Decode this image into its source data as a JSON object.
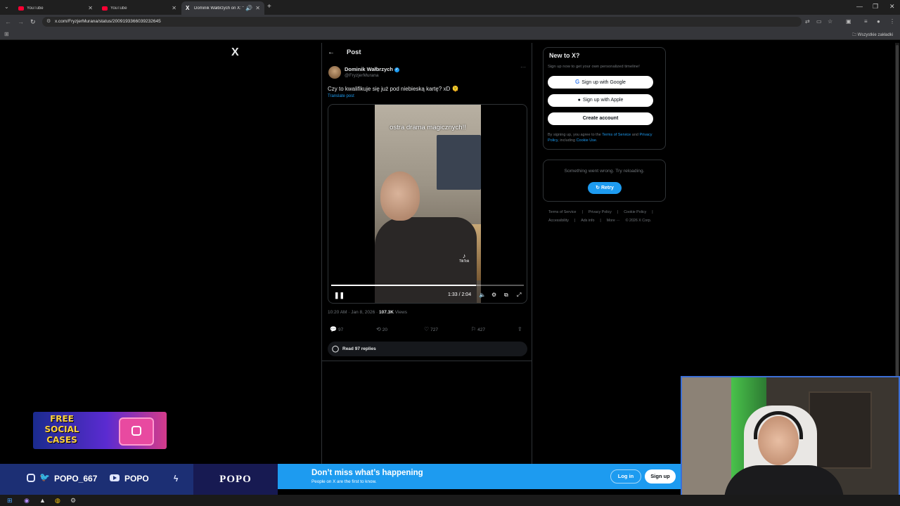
{
  "browser": {
    "tabs": [
      {
        "title": "YouTube",
        "active": false
      },
      {
        "title": "YouTube",
        "active": false
      },
      {
        "title": "Dominik Wałbrzych on X: \"",
        "active": true
      }
    ],
    "url": "x.com/FryzjerMurana/status/2009193366039232645",
    "bookmarks_label": "Wszystkie zakładki"
  },
  "header": {
    "x_logo": "X",
    "back": "←",
    "title": "Post"
  },
  "post": {
    "author": "Dominik Wałbrzych",
    "verified": "✓",
    "handle": "@FryzjerMurana",
    "more": "···",
    "text": "Czy to kwalifikuje się już pod niebieską kartę? xD 🫠",
    "translate": "Translate post",
    "video": {
      "caption": "ostra drama magicznych!!",
      "watermark": "TikTok",
      "time": "1:33 / 2:04",
      "progress": 0.75,
      "play_pause": "❚❚"
    },
    "timestamp": "10:20 AM · Jan 8, 2026 · ",
    "views_count": "107.3K",
    "views_label": " Views",
    "stats": {
      "replies": "97",
      "reposts": "20",
      "likes": "727",
      "bookmarks": "427"
    },
    "read_replies": "Read 97 replies"
  },
  "sidebar": {
    "new_title": "New to X?",
    "new_subtitle": "Sign up now to get your own personalized timeline!",
    "google_btn": "Sign up with Google",
    "apple_btn": "Sign up with Apple",
    "create_btn": "Create account",
    "legal_prefix": "By signing up, you agree to the ",
    "legal_terms": "Terms of Service",
    "legal_and": " and ",
    "legal_privacy": "Privacy Policy",
    "legal_including": ", including ",
    "legal_cookie": "Cookie Use",
    "legal_end": ".",
    "error_text": "Something went wrong. Try reloading.",
    "retry": "Retry",
    "footer": [
      "Terms of Service",
      "|",
      "Privacy Policy",
      "|",
      "Cookie Policy",
      "|",
      "Accessibility",
      "|",
      "Ads info",
      "|",
      "More ···",
      "© 2026 X Corp."
    ]
  },
  "banner": {
    "title": "Don’t miss what’s happening",
    "subtitle": "People on X are the first to know.",
    "login": "Log in",
    "signup": "Sign up"
  },
  "overlay": {
    "handle1": "POPO_667",
    "handle2": "POPO",
    "brand": "POPO",
    "promo_line1": "FREE",
    "promo_line2": "SOCIAL",
    "promo_line3": "CASES"
  },
  "colors": {
    "accent": "#1d9bf0",
    "background": "#000000",
    "border": "#2f3336"
  }
}
